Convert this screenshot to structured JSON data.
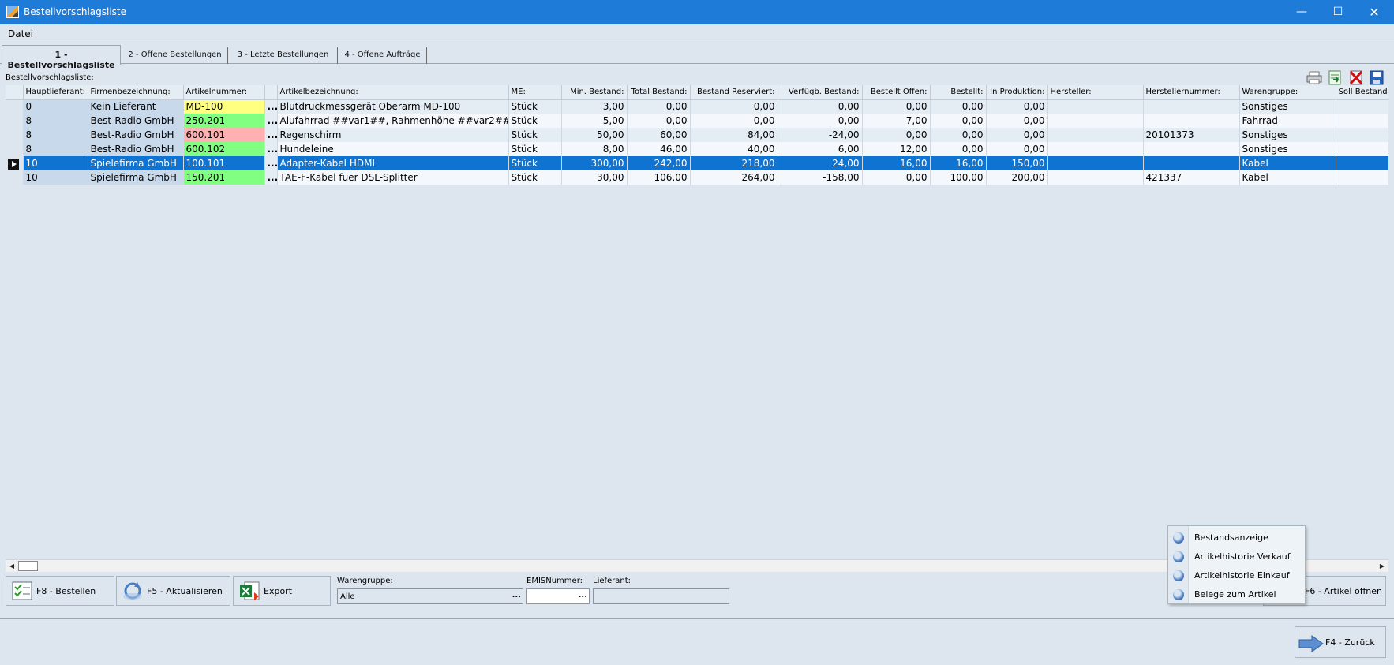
{
  "window": {
    "title": "Bestellvorschlagsliste"
  },
  "menu": {
    "datei": "Datei"
  },
  "tabs": [
    {
      "label": "1 - Bestellvorschlagsliste",
      "active": true
    },
    {
      "label": "2 - Offene Bestellungen",
      "active": false
    },
    {
      "label": "3 - Letzte Bestellungen",
      "active": false
    },
    {
      "label": "4 - Offene Aufträge",
      "active": false
    }
  ],
  "list_label": "Bestellvorschlagsliste:",
  "toolbar_icons": [
    "printer-icon",
    "export-sheet-icon",
    "delete-icon",
    "save-icon"
  ],
  "columns": [
    "Hauptlieferant:",
    "Firmenbezeichnung:",
    "Artikelnummer:",
    "",
    "Artikelbezeichnung:",
    "ME:",
    "Min. Bestand:",
    "Total Bestand:",
    "Bestand Reserviert:",
    "Verfügb. Bestand:",
    "Bestellt Offen:",
    "Bestellt:",
    "In Produktion:",
    "Hersteller:",
    "Herstellernummer:",
    "Warengruppe:",
    "Soll Bestand"
  ],
  "rows": [
    {
      "hauptlieferant": "0",
      "firma": "Kein Lieferant",
      "artikelnummer": "MD-100",
      "art_color": "#ffff80",
      "dots": "...",
      "bezeichnung": "Blutdruckmessgerät Oberarm MD-100",
      "me": "Stück",
      "min": "3,00",
      "total": "0,00",
      "reserviert": "0,00",
      "verfuegbar": "0,00",
      "offen": "0,00",
      "bestellt": "0,00",
      "produktion": "0,00",
      "hersteller": "",
      "herstellernummer": "",
      "warengruppe": "Sonstiges",
      "soll": "",
      "selected": false
    },
    {
      "hauptlieferant": "8",
      "firma": "Best-Radio GmbH",
      "artikelnummer": "250.201",
      "art_color": "#80ff80",
      "dots": "...",
      "bezeichnung": "Alufahrrad ##var1##, Rahmenhöhe ##var2##",
      "me": "Stück",
      "min": "5,00",
      "total": "0,00",
      "reserviert": "0,00",
      "verfuegbar": "0,00",
      "offen": "7,00",
      "bestellt": "0,00",
      "produktion": "0,00",
      "hersteller": "",
      "herstellernummer": "",
      "warengruppe": "Fahrrad",
      "soll": "",
      "selected": false
    },
    {
      "hauptlieferant": "8",
      "firma": "Best-Radio GmbH",
      "artikelnummer": "600.101",
      "art_color": "#ffb0b0",
      "dots": "...",
      "bezeichnung": "Regenschirm",
      "me": "Stück",
      "min": "50,00",
      "total": "60,00",
      "reserviert": "84,00",
      "verfuegbar": "-24,00",
      "offen": "0,00",
      "bestellt": "0,00",
      "produktion": "0,00",
      "hersteller": "",
      "herstellernummer": "20101373",
      "warengruppe": "Sonstiges",
      "soll": "",
      "selected": false
    },
    {
      "hauptlieferant": "8",
      "firma": "Best-Radio GmbH",
      "artikelnummer": "600.102",
      "art_color": "#80ff80",
      "dots": "...",
      "bezeichnung": "Hundeleine",
      "me": "Stück",
      "min": "8,00",
      "total": "46,00",
      "reserviert": "40,00",
      "verfuegbar": "6,00",
      "offen": "12,00",
      "bestellt": "0,00",
      "produktion": "0,00",
      "hersteller": "",
      "herstellernummer": "",
      "warengruppe": "Sonstiges",
      "soll": "",
      "selected": false
    },
    {
      "hauptlieferant": "10",
      "firma": "Spielefirma GmbH",
      "artikelnummer": "100.101",
      "art_color": "#0f74d1",
      "dots": "...",
      "bezeichnung": "Adapter-Kabel HDMI",
      "me": "Stück",
      "min": "300,00",
      "total": "242,00",
      "reserviert": "218,00",
      "verfuegbar": "24,00",
      "offen": "16,00",
      "bestellt": "16,00",
      "produktion": "150,00",
      "hersteller": "",
      "herstellernummer": "",
      "warengruppe": "Kabel",
      "soll": "",
      "selected": true
    },
    {
      "hauptlieferant": "10",
      "firma": "Spielefirma GmbH",
      "artikelnummer": "150.201",
      "art_color": "#80ff80",
      "dots": "...",
      "bezeichnung": "TAE-F-Kabel fuer DSL-Splitter",
      "me": "Stück",
      "min": "30,00",
      "total": "106,00",
      "reserviert": "264,00",
      "verfuegbar": "-158,00",
      "offen": "0,00",
      "bestellt": "100,00",
      "produktion": "200,00",
      "hersteller": "",
      "herstellernummer": "421337",
      "warengruppe": "Kabel",
      "soll": "",
      "selected": false
    }
  ],
  "buttons": {
    "bestellen": "F8 - Bestellen",
    "aktualisieren": "F5 - Aktualisieren",
    "export": "Export",
    "artikel_oeffnen": "F6 - Artikel öffnen",
    "zurueck": "F4 - Zurück"
  },
  "filters": {
    "warengruppe_label": "Warengruppe:",
    "warengruppe_value": "Alle",
    "emis_label": "EMISNummer:",
    "emis_value": "",
    "lieferant_label": "Lieferant:",
    "lieferant_value": ""
  },
  "context_menu": [
    {
      "label": "Bestandsanzeige"
    },
    {
      "label": "Artikelhistorie Verkauf"
    },
    {
      "label": "Artikelhistorie Einkauf"
    },
    {
      "label": "Belege zum Artikel"
    }
  ],
  "colors": {
    "titlebar": "#1f7bd8",
    "selection": "#0f74d1",
    "background": "#dde6ef"
  }
}
